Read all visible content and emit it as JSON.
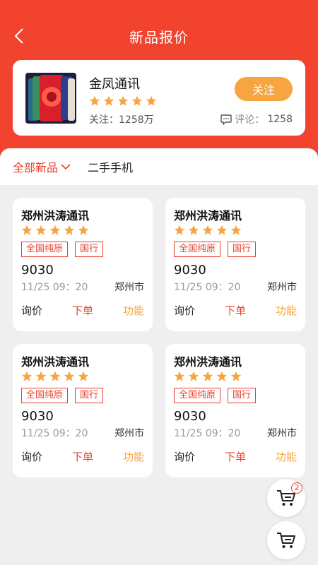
{
  "header": {
    "title": "新品报价"
  },
  "shop": {
    "name": "金凤通讯",
    "rating": 5,
    "followers_label": "关注：",
    "followers_value": "1258万",
    "follow_button": "关注",
    "comments_label": "评论：",
    "comments_value": "1258"
  },
  "tabs": [
    {
      "label": "全部新品",
      "active": true
    },
    {
      "label": "二手手机",
      "active": false
    }
  ],
  "listings": [
    {
      "name": "郑州洪涛通讯",
      "rating": 5,
      "tags": [
        "全国纯原",
        "国行"
      ],
      "price": "9030",
      "time": "11/25  09：20",
      "city": "郑州市",
      "actions": [
        "询价",
        "下单",
        "功能"
      ]
    },
    {
      "name": "郑州洪涛通讯",
      "rating": 5,
      "tags": [
        "全国纯原",
        "国行"
      ],
      "price": "9030",
      "time": "11/25  09：20",
      "city": "郑州市",
      "actions": [
        "询价",
        "下单",
        "功能"
      ]
    },
    {
      "name": "郑州洪涛通讯",
      "rating": 5,
      "tags": [
        "全国纯原",
        "国行"
      ],
      "price": "9030",
      "time": "11/25  09：20",
      "city": "郑州市",
      "actions": [
        "询价",
        "下单",
        "功能"
      ]
    },
    {
      "name": "郑州洪涛通讯",
      "rating": 5,
      "tags": [
        "全国纯原",
        "国行"
      ],
      "price": "9030",
      "time": "11/25  09：20",
      "city": "郑州市",
      "actions": [
        "询价",
        "下单",
        "功能"
      ]
    }
  ],
  "cart_fab": {
    "badge": "2"
  },
  "colors": {
    "brand_red": "#f2432f",
    "accent_orange": "#f7a540",
    "star": "#f7a540"
  },
  "icons": [
    "back-arrow-icon",
    "star-icon",
    "comment-icon",
    "chevron-down-icon",
    "cart-icon",
    "phone-thumbnail"
  ]
}
